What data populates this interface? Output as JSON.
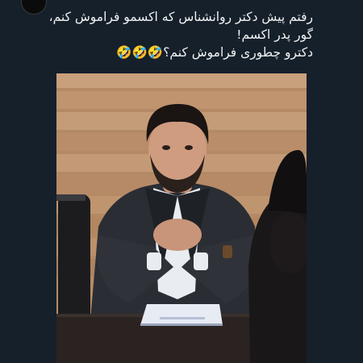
{
  "post": {
    "caption_lines": [
      "رفتم پیش دکتر روانشناس که اکسمو فراموش کنم،",
      "گور پدر اکسم!",
      "دکترو چطوری فراموش کنم؟🤣🤣🤣"
    ]
  },
  "colors": {
    "background": "#15202b",
    "text": "#f2f2f2",
    "wall_light": "#c9a07c",
    "wall_dark": "#a57a58",
    "suit": "#2a2d33",
    "shirt": "#e9edf2",
    "desk": "#2b2321"
  },
  "icons": {
    "avatar": "profile-avatar"
  }
}
